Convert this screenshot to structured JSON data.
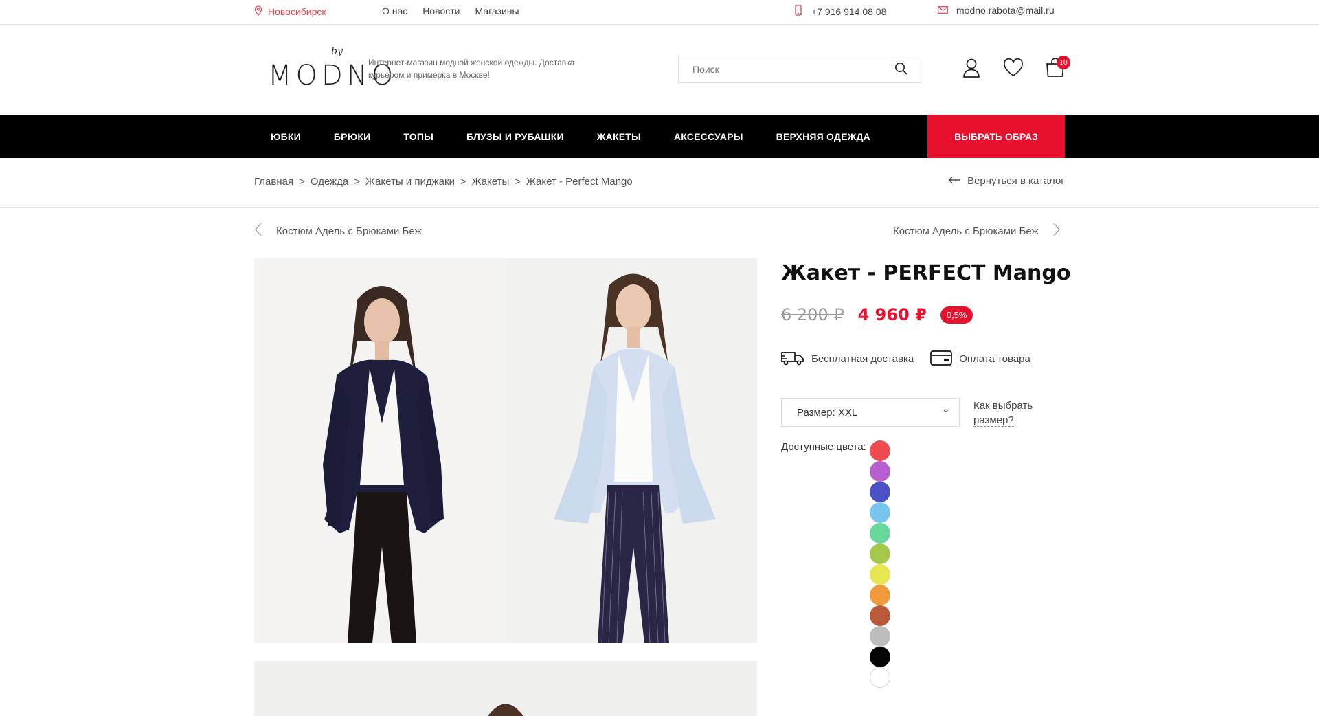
{
  "topbar": {
    "city": "Новосибирск",
    "nav": [
      "О нас",
      "Новости",
      "Магазины"
    ],
    "phone": "+7 916 914 08 08",
    "email": "modno.rabota@mail.ru"
  },
  "header": {
    "logo_by": "by",
    "logo_word": "MODNO",
    "tagline": "Интернет-магазин модной женской одежды. Доставка курьером и примерка в Москве!",
    "search_placeholder": "Поиск",
    "cart_count": "10"
  },
  "mainnav": {
    "items": [
      "Юбки",
      "Брюки",
      "Топы",
      "Блузы и рубашки",
      "Жакеты",
      "Аксессуары",
      "Верхняя одежда"
    ],
    "cta": "Выбрать образ"
  },
  "breadcrumbs": [
    "Главная",
    "Одежда",
    "Жакеты и пиджаки",
    "Жакеты",
    "Жакет - Perfect Mango"
  ],
  "breadcrumb_sep": ">",
  "back_link": "Вернуться в каталог",
  "prev_product": "Костюм Адель с Брюками Беж",
  "next_product": "Костюм Адель с Брюками Беж",
  "product": {
    "title": "Жакет - PERFECT Mango",
    "old_price": "6 200 ₽",
    "new_price": "4 960 ₽",
    "discount": "0,5%",
    "delivery_link": "Бесплатная доставка",
    "payment_link": "Оплата товара",
    "size_label": "Размер: XXL",
    "size_help": "Как выбрать размер?",
    "colors_label": "Доступные цвета:",
    "colors": [
      "#ef4a4f",
      "#b55fd1",
      "#4b52c8",
      "#77c5ec",
      "#68d89b",
      "#a5c84b",
      "#e6e650",
      "#f09a3c",
      "#b85a3a",
      "#bdbdbd",
      "#050505",
      "#ffffff"
    ]
  }
}
